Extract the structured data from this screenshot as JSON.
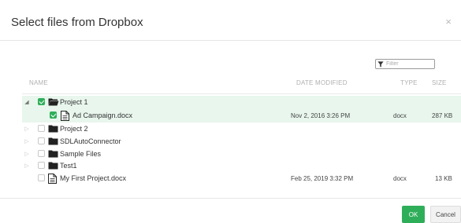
{
  "dialog": {
    "title": "Select files from Dropbox",
    "close_glyph": "×"
  },
  "filter": {
    "placeholder": "Filter",
    "value": "",
    "icon": "filter-icon"
  },
  "columns": {
    "name": "NAME",
    "date_modified": "DATE MODIFIED",
    "type": "TYPE",
    "size": "SIZE"
  },
  "rows": [
    {
      "label": "Project 1",
      "kind": "folder-open",
      "expanded": true,
      "checked": true,
      "selected": true,
      "date": "",
      "type": "",
      "size": ""
    },
    {
      "label": "Ad Campaign.docx",
      "kind": "document",
      "checked": true,
      "selected": true,
      "date": "Nov 2, 2016 3:26 PM",
      "type": "docx",
      "size": "287 KB"
    },
    {
      "label": "Project 2",
      "kind": "folder",
      "expanded": false,
      "checked": false,
      "date": "",
      "type": "",
      "size": ""
    },
    {
      "label": "SDLAutoConnector",
      "kind": "folder",
      "expanded": false,
      "checked": false,
      "date": "",
      "type": "",
      "size": ""
    },
    {
      "label": "Sample Files",
      "kind": "folder",
      "expanded": false,
      "checked": false,
      "date": "",
      "type": "",
      "size": ""
    },
    {
      "label": "Test1",
      "kind": "folder",
      "expanded": false,
      "checked": false,
      "date": "",
      "type": "",
      "size": ""
    },
    {
      "label": "My First Project.docx",
      "kind": "document",
      "checked": false,
      "date": "Feb 25, 2019 3:32 PM",
      "type": "docx",
      "size": "13 KB"
    }
  ],
  "buttons": {
    "ok": "OK",
    "cancel": "Cancel"
  },
  "colors": {
    "accent": "#2fae5a",
    "selected_row": "#e8f6ed"
  }
}
